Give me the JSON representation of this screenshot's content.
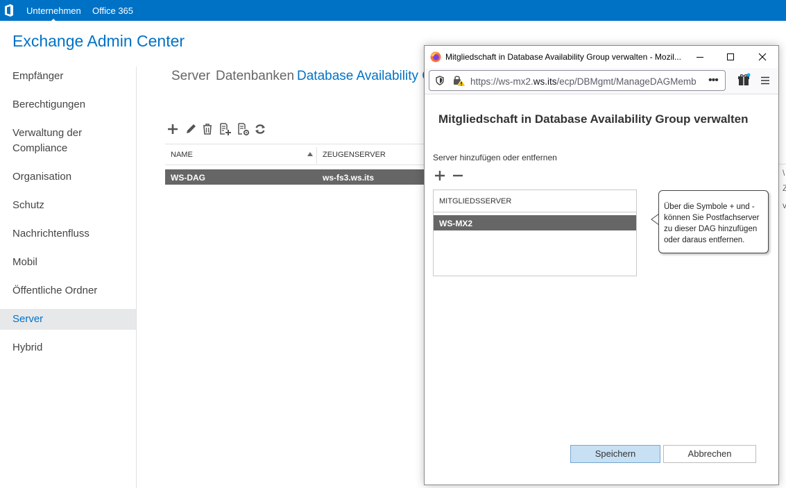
{
  "topbar": {
    "links": [
      "Unternehmen",
      "Office 365"
    ]
  },
  "app": {
    "title": "Exchange Admin Center"
  },
  "nav": {
    "items": [
      "Empfänger",
      "Berechtigungen",
      "Verwaltung der",
      "Compliance",
      "Organisation",
      "Schutz",
      "Nachrichtenfluss",
      "Mobil",
      "Öffentliche Ordner",
      "Server",
      "Hybrid"
    ]
  },
  "tabs": [
    "Server",
    "Datenbanken",
    "Database Availability Gr"
  ],
  "list": {
    "columns": [
      "NAME",
      "ZEUGENSERVER"
    ],
    "rows": [
      {
        "name": "WS-DAG",
        "witness": "ws-fs3.ws.its"
      }
    ]
  },
  "background_right": [
    "\\",
    "Z",
    "v"
  ],
  "popup": {
    "window_title": "Mitgliedschaft in Database Availability Group verwalten - Mozil...",
    "url_prefix": "https://ws-mx2.",
    "url_host": "ws.its",
    "url_rest": "/ecp/DBMgmt/ManageDAGMemb",
    "url_more": "•••",
    "dialog_title": "Mitgliedschaft in Database Availability Group verwalten",
    "section_label": "Server hinzufügen oder entfernen",
    "member_header": "MITGLIEDSSERVER",
    "members": [
      "WS-MX2"
    ],
    "callout": "Über die Symbole + und - können Sie Postfachserver zu dieser DAG hinzufügen oder daraus entfernen.",
    "save_label": "Speichern",
    "cancel_label": "Abbrechen"
  },
  "colors": {
    "accent": "#0072c6",
    "selected_row": "#666666",
    "save_button": "#c7e0f4"
  }
}
